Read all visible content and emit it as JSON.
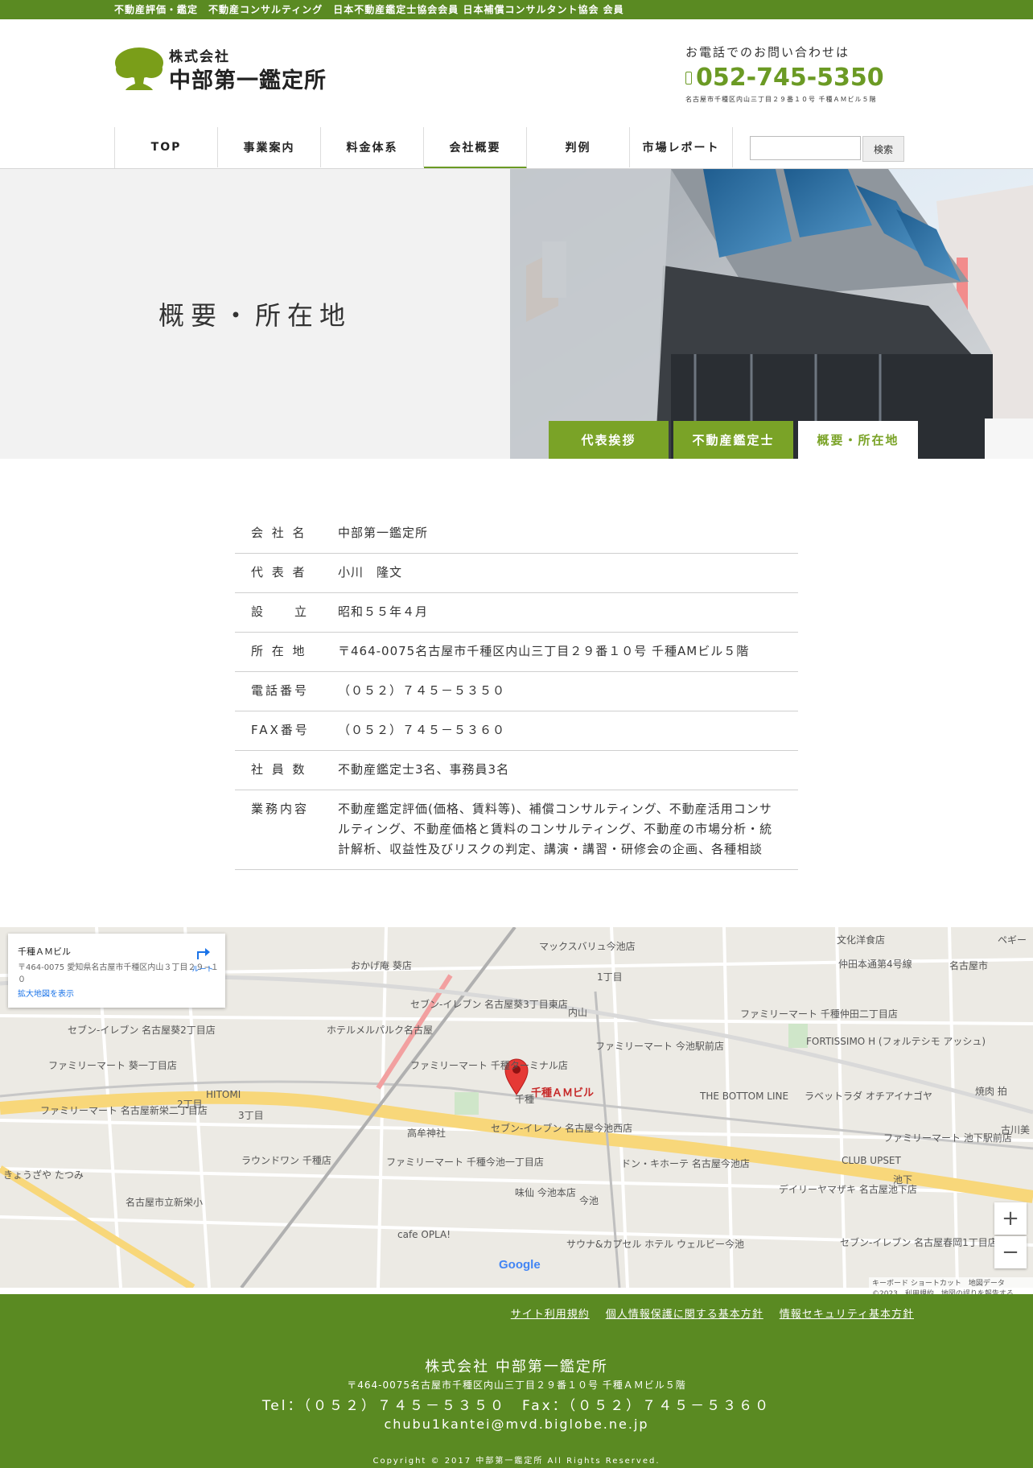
{
  "topbar": {
    "text": "不動産評価・鑑定　不動産コンサルティング　日本不動産鑑定士協会会員 日本補償コンサルタント協会 会員"
  },
  "logo": {
    "small": "株式会社",
    "big": "中部第一鑑定所",
    "color": "#7a9e19"
  },
  "contact": {
    "label": "お電話でのお問い合わせは",
    "phone": "052-745-5350",
    "address": "名古屋市千種区内山三丁目２９番１０号 千種ＡＭビル５階"
  },
  "nav": {
    "items": [
      "TOP",
      "事業案内",
      "料金体系",
      "会社概要",
      "判例",
      "市場レポート"
    ],
    "active": "会社概要"
  },
  "search": {
    "placeholder": "",
    "button": "検索"
  },
  "hero": {
    "title": "概要・所在地",
    "tabs": [
      "代表挨拶",
      "不動産鑑定士",
      "概要・所在地"
    ],
    "active_tab": "概要・所在地"
  },
  "info": {
    "rows": [
      {
        "label": "会 社 名",
        "value": "中部第一鑑定所"
      },
      {
        "label": "代 表 者",
        "value": "小川　隆文"
      },
      {
        "label": "設　　立",
        "value": "昭和５５年４月"
      },
      {
        "label": "所 在 地",
        "value": "〒464-0075名古屋市千種区内山三丁目２９番１０号 千種AMビル５階"
      },
      {
        "label": "電話番号",
        "value": "（０５２）７４５－５３５０"
      },
      {
        "label": "FAX番号",
        "value": "（０５２）７４５－５３６０"
      },
      {
        "label": "社 員 数",
        "value": "不動産鑑定士3名、事務員3名"
      },
      {
        "label": "業務内容",
        "value": "不動産鑑定評価(価格、賃料等)、補償コンサルティング、不動産活用コンサルティング、不動産価格と賃料のコンサルティング、不動産の市場分析・統計解析、収益性及びリスクの判定、講演・講習・研修会の企画、各種相談"
      }
    ]
  },
  "map": {
    "card_name": "千種ＡＭビル",
    "card_addr": "〒464-0075 愛知県名古屋市千種区内山３丁目２９−１０",
    "card_link": "拡大地図を表示",
    "route": "ルート",
    "pin_label": "千種ＡＭビル",
    "labels": [
      "マックスバリュ今池店",
      "文化洋食店",
      "仲田本通第4号線",
      "名古屋市",
      "ペギー",
      "おかげ庵 葵店",
      "セブン-イレブン 名古屋葵3丁目東店",
      "ホテルメルパルク名古屋",
      "ファミリーマート 今池駅前店",
      "ファミリーマート 千種仲田二丁目店",
      "FORTISSIMO H (フォルテシモ アッシュ)",
      "ファミリーマート 千種ターミナル店",
      "THE BOTTOM LINE",
      "ラベットラダ オチアイナゴヤ",
      "セブン-イレブン 名古屋葵2丁目店",
      "ファミリーマート 葵一丁目店",
      "ファミリーマート 名古屋新栄二丁目店",
      "HITOMI",
      "高牟神社",
      "セブン-イレブン 名古屋今池西店",
      "ファミリーマート 千種今池一丁目店",
      "ラウンドワン 千種店",
      "ドン・キホーテ 名古屋今池店",
      "味仙 今池本店",
      "デイリーヤマザキ 名古屋池下店",
      "CLUB UPSET",
      "ファミリーマート 池下駅前店",
      "きょうざや たつみ",
      "名古屋市立新栄小",
      "cafe OPLA!",
      "サウナ&カプセル ホテル ウェルビー今池",
      "セブン-イレブン 名古屋春岡1丁目店",
      "焼肉 拍",
      "古川美",
      "内山",
      "今池",
      "千種",
      "池下",
      "2丁目",
      "3丁目",
      "1丁目"
    ],
    "attribution": "キーボード ショートカット　地図データ ©2023　利用規約　地図の誤りを報告する"
  },
  "footer": {
    "links": [
      "サイト利用規約",
      "個人情報保護に関する基本方針",
      "情報セキュリティ基本方針"
    ],
    "company": "株式会社 中部第一鑑定所",
    "address": "〒464-0075名古屋市千種区内山三丁目２９番１０号 千種ＡＭビル５階",
    "tel": "Tel：（０５２）７４５－５３５０　Fax：（０５２）７４５－５３６０",
    "email": "chubu1kantei@mvd.biglobe.ne.jp",
    "copyright": "Copyright © 2017 中部第一鑑定所 All Rights Reserved."
  },
  "colors": {
    "brand_green": "#5a8a22",
    "accent_green": "#7aa327",
    "map_pin": "#e53935"
  }
}
